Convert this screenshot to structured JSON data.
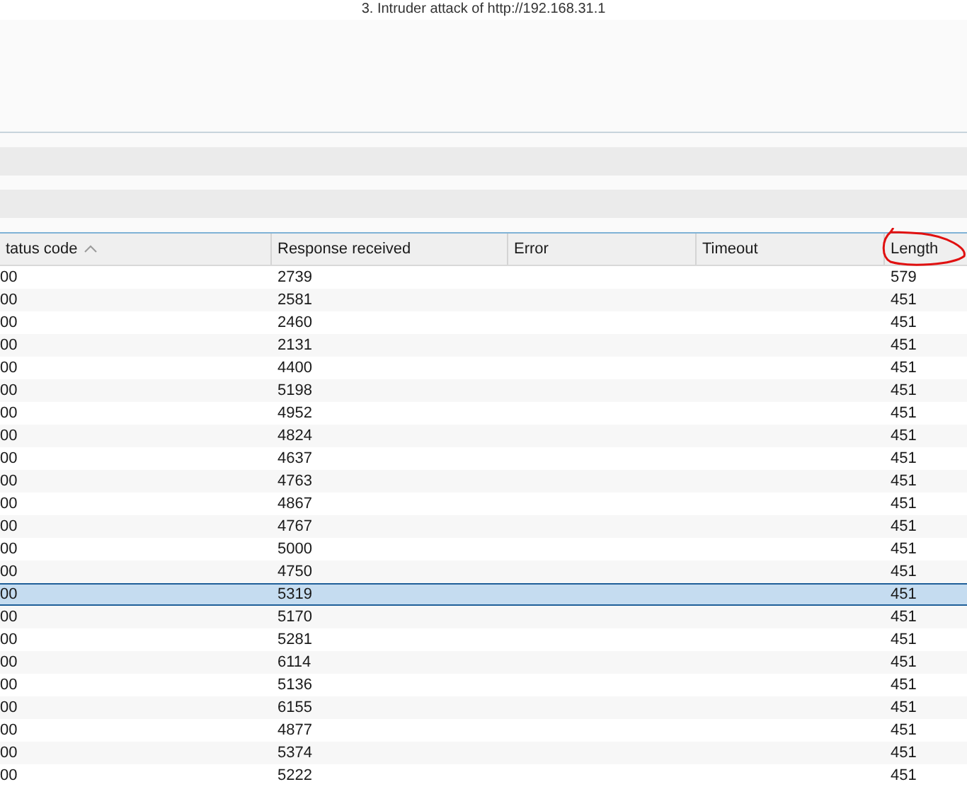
{
  "window": {
    "title": "3. Intruder attack of http://192.168.31.1"
  },
  "table": {
    "columns": [
      {
        "label": "tatus code",
        "sorted": true
      },
      {
        "label": "Response received",
        "sorted": false
      },
      {
        "label": "Error",
        "sorted": false
      },
      {
        "label": "Timeout",
        "sorted": false
      },
      {
        "label": "Length",
        "sorted": false
      }
    ],
    "rows": [
      {
        "status": "00",
        "response": "2739",
        "length": "579",
        "selected": false
      },
      {
        "status": "00",
        "response": "2581",
        "length": "451",
        "selected": false
      },
      {
        "status": "00",
        "response": "2460",
        "length": "451",
        "selected": false
      },
      {
        "status": "00",
        "response": "2131",
        "length": "451",
        "selected": false
      },
      {
        "status": "00",
        "response": "4400",
        "length": "451",
        "selected": false
      },
      {
        "status": "00",
        "response": "5198",
        "length": "451",
        "selected": false
      },
      {
        "status": "00",
        "response": "4952",
        "length": "451",
        "selected": false
      },
      {
        "status": "00",
        "response": "4824",
        "length": "451",
        "selected": false
      },
      {
        "status": "00",
        "response": "4637",
        "length": "451",
        "selected": false
      },
      {
        "status": "00",
        "response": "4763",
        "length": "451",
        "selected": false
      },
      {
        "status": "00",
        "response": "4867",
        "length": "451",
        "selected": false
      },
      {
        "status": "00",
        "response": "4767",
        "length": "451",
        "selected": false
      },
      {
        "status": "00",
        "response": "5000",
        "length": "451",
        "selected": false
      },
      {
        "status": "00",
        "response": "4750",
        "length": "451",
        "selected": false
      },
      {
        "status": "00",
        "response": "5319",
        "length": "451",
        "selected": true
      },
      {
        "status": "00",
        "response": "5170",
        "length": "451",
        "selected": false
      },
      {
        "status": "00",
        "response": "5281",
        "length": "451",
        "selected": false
      },
      {
        "status": "00",
        "response": "6114",
        "length": "451",
        "selected": false
      },
      {
        "status": "00",
        "response": "5136",
        "length": "451",
        "selected": false
      },
      {
        "status": "00",
        "response": "6155",
        "length": "451",
        "selected": false
      },
      {
        "status": "00",
        "response": "4877",
        "length": "451",
        "selected": false
      },
      {
        "status": "00",
        "response": "5374",
        "length": "451",
        "selected": false
      },
      {
        "status": "00",
        "response": "5222",
        "length": "451",
        "selected": false
      }
    ]
  }
}
